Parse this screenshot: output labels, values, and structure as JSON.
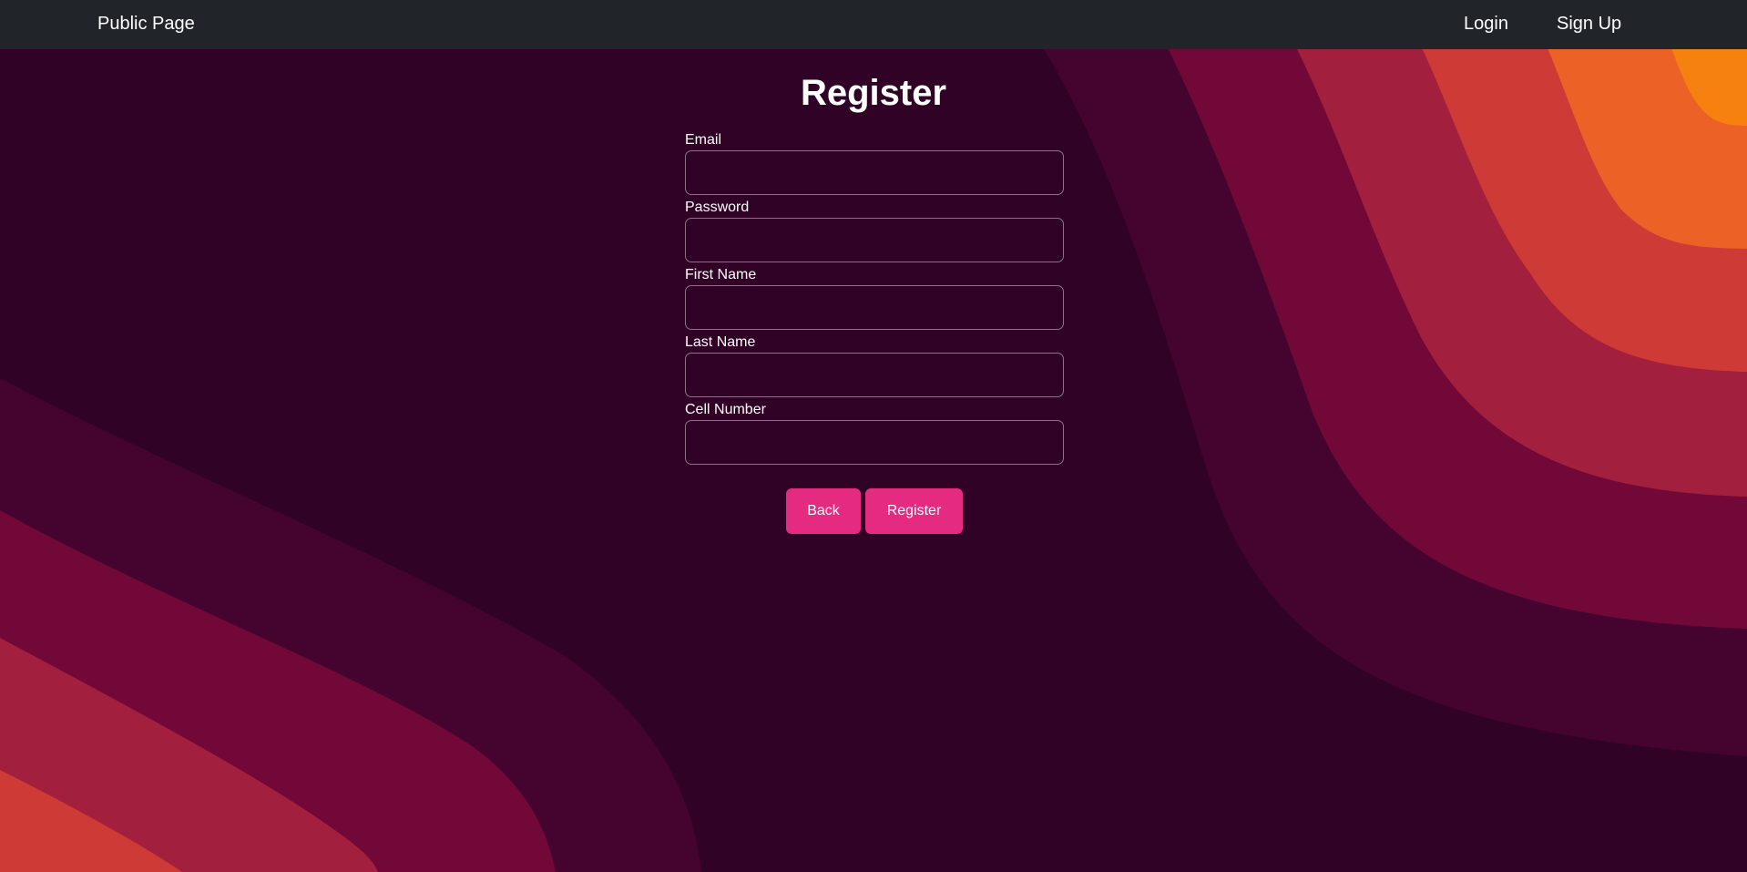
{
  "navbar": {
    "brand": "Public Page",
    "login": "Login",
    "signup": "Sign Up"
  },
  "form": {
    "title": "Register",
    "fields": [
      {
        "label": "Email",
        "value": ""
      },
      {
        "label": "Password",
        "value": ""
      },
      {
        "label": "First Name",
        "value": ""
      },
      {
        "label": "Last Name",
        "value": ""
      },
      {
        "label": "Cell Number",
        "value": ""
      }
    ],
    "back_label": "Back",
    "register_label": "Register"
  },
  "colors": {
    "navbar_bg": "#212529",
    "page_bg": "#300226",
    "button": "#e52a82",
    "wave_1": "#45042f",
    "wave_2": "#710838",
    "wave_3": "#a21f3d",
    "wave_4": "#ce3a35",
    "wave_5": "#ec6125",
    "wave_6": "#f7810f"
  }
}
